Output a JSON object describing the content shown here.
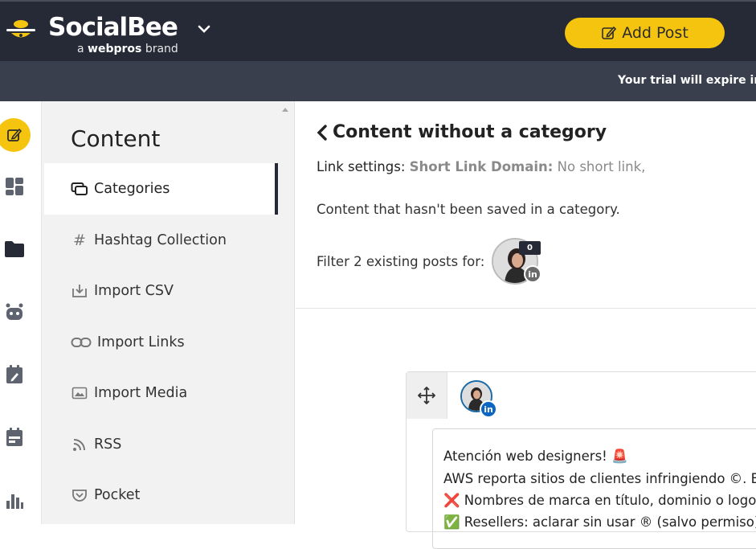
{
  "header": {
    "brand": "SocialBee",
    "brand_sub_prefix": "a",
    "brand_sub_name": "webpros",
    "brand_sub_suffix": "brand",
    "add_post_label": "Add Post",
    "accent": "#f5c40e"
  },
  "trial_banner": {
    "text": "Your trial will expire in"
  },
  "rail": {
    "icons": [
      "edit-icon",
      "dashboard-icon",
      "folder-icon",
      "robot-icon",
      "calendar-edit-icon",
      "calendar-icon",
      "analytics-icon"
    ]
  },
  "subnav": {
    "title": "Content",
    "items": [
      {
        "label": "Categories",
        "icon": "categories-icon"
      },
      {
        "label": "Hashtag Collection",
        "icon": "hashtag-icon"
      },
      {
        "label": "Import CSV",
        "icon": "import-icon"
      },
      {
        "label": "Import Links",
        "icon": "link-icon"
      },
      {
        "label": "Import Media",
        "icon": "image-icon"
      },
      {
        "label": "RSS",
        "icon": "rss-icon"
      },
      {
        "label": "Pocket",
        "icon": "pocket-icon"
      }
    ]
  },
  "main": {
    "title": "Content without a category",
    "link_settings_label": "Link settings:",
    "short_link_label": "Short Link Domain:",
    "short_link_value": "No short link,",
    "description": "Content that hasn't been saved in a category.",
    "filter_text": "Filter 2 existing posts for:",
    "profile_post_count": "0",
    "network_badge": "in"
  },
  "post": {
    "network_badge": "in",
    "lines": [
      "Atención web designers! 🚨",
      "AWS reporta sitios de clientes infringiendo ©. Ev",
      "❌ Nombres de marca en título, dominio o logo",
      "✅ Resellers: aclarar sin usar ® (salvo permiso)"
    ]
  }
}
